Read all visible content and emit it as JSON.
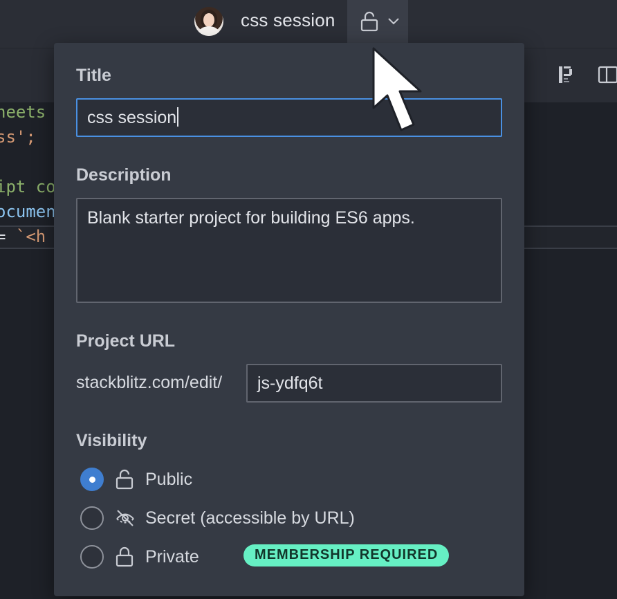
{
  "header": {
    "project_name": "css session",
    "avatar_icon": "user-avatar",
    "visibility_icon": "unlock-icon",
    "menu_icon": "chevron-down-icon"
  },
  "editor": {
    "lines": [
      {
        "text": "heets",
        "color": "green"
      },
      {
        "text": "ss';",
        "color": "orange"
      },
      {
        "text": "ipt coc",
        "color": "green"
      },
      {
        "text": "ocument",
        "color": "blue"
      },
      {
        "text": "= `<h",
        "color": "mixed"
      }
    ]
  },
  "popover": {
    "title_label": "Title",
    "title_value": "css session",
    "description_label": "Description",
    "description_value": "Blank starter project for building ES6 apps.",
    "url_label": "Project URL",
    "url_prefix": "stackblitz.com/edit/",
    "url_slug": "js-ydfq6t",
    "visibility_label": "Visibility",
    "options": [
      {
        "label": "Public",
        "icon": "unlock-icon",
        "checked": true
      },
      {
        "label": "Secret (accessible by URL)",
        "icon": "eye-off-icon",
        "checked": false
      },
      {
        "label": "Private",
        "icon": "lock-icon",
        "checked": false,
        "badge": "MEMBERSHIP REQUIRED"
      }
    ]
  },
  "colors": {
    "accent": "#4a90e2",
    "radio_checked": "#3f7ed0",
    "badge_bg": "#66f0c4",
    "panel_bg": "#353a44"
  }
}
